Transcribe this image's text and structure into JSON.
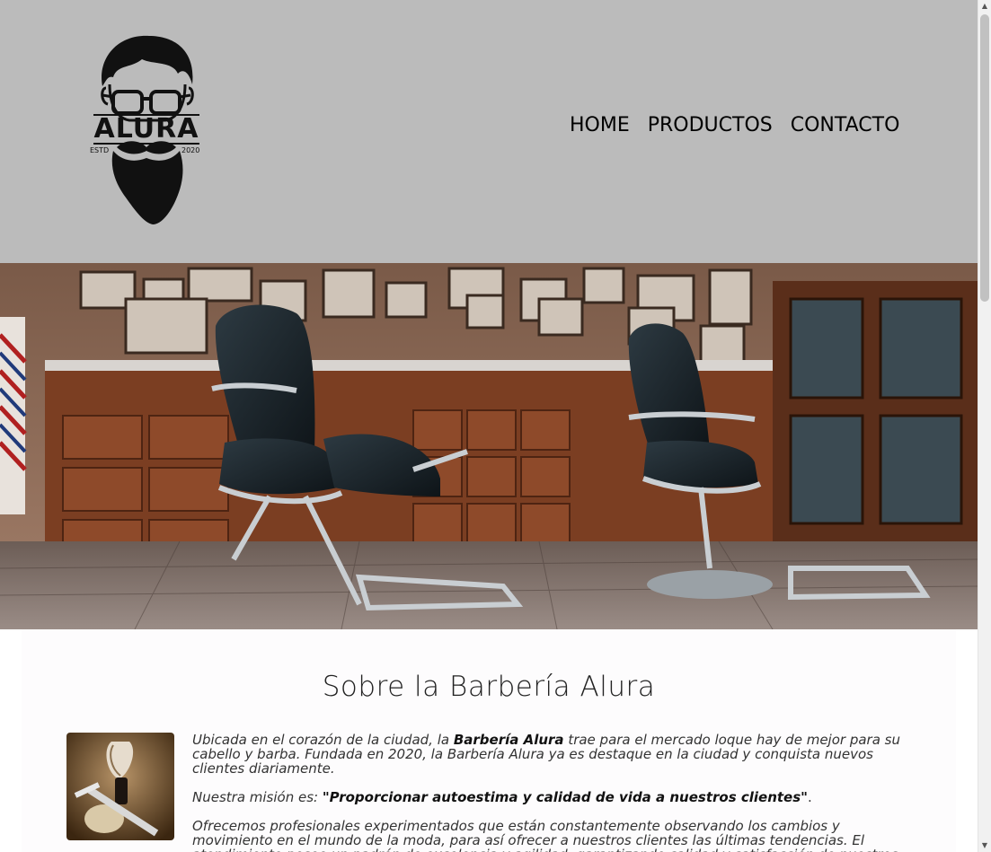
{
  "header": {
    "logo": {
      "brand": "ALURA",
      "left_text": "ESTD",
      "right_text": "2020"
    },
    "nav": [
      {
        "label": "HOME"
      },
      {
        "label": "PRODUCTOS"
      },
      {
        "label": "CONTACTO"
      }
    ]
  },
  "about": {
    "title": "Sobre la Barbería Alura",
    "p1": {
      "a": "Ubicada en el corazón de la ciudad, la ",
      "b": "Barbería Alura",
      "c": " trae para el mercado loque hay de mejor para su cabello y barba. Fundada en 2020, la Barbería Alura ya es destaque en la ciudad y conquista nuevos clientes diariamente."
    },
    "p2": {
      "a": "Nuestra misión es: ",
      "b": "\"Proporcionar autoestima y calidad de vida a nuestros clientes\"",
      "c": "."
    },
    "p3": "Ofrecemos profesionales experimentados que están constantemente observando los cambios y movimiento en el mundo de la moda, para así ofrecer a nuestros clientes las últimas tendencias. El atendimiento posee un padrón de excelencia y agilidad, garantizando calidad y satisfacción de nuestros clientes."
  },
  "colors": {
    "header_bg": "#bbbbbb",
    "text": "#333333"
  }
}
